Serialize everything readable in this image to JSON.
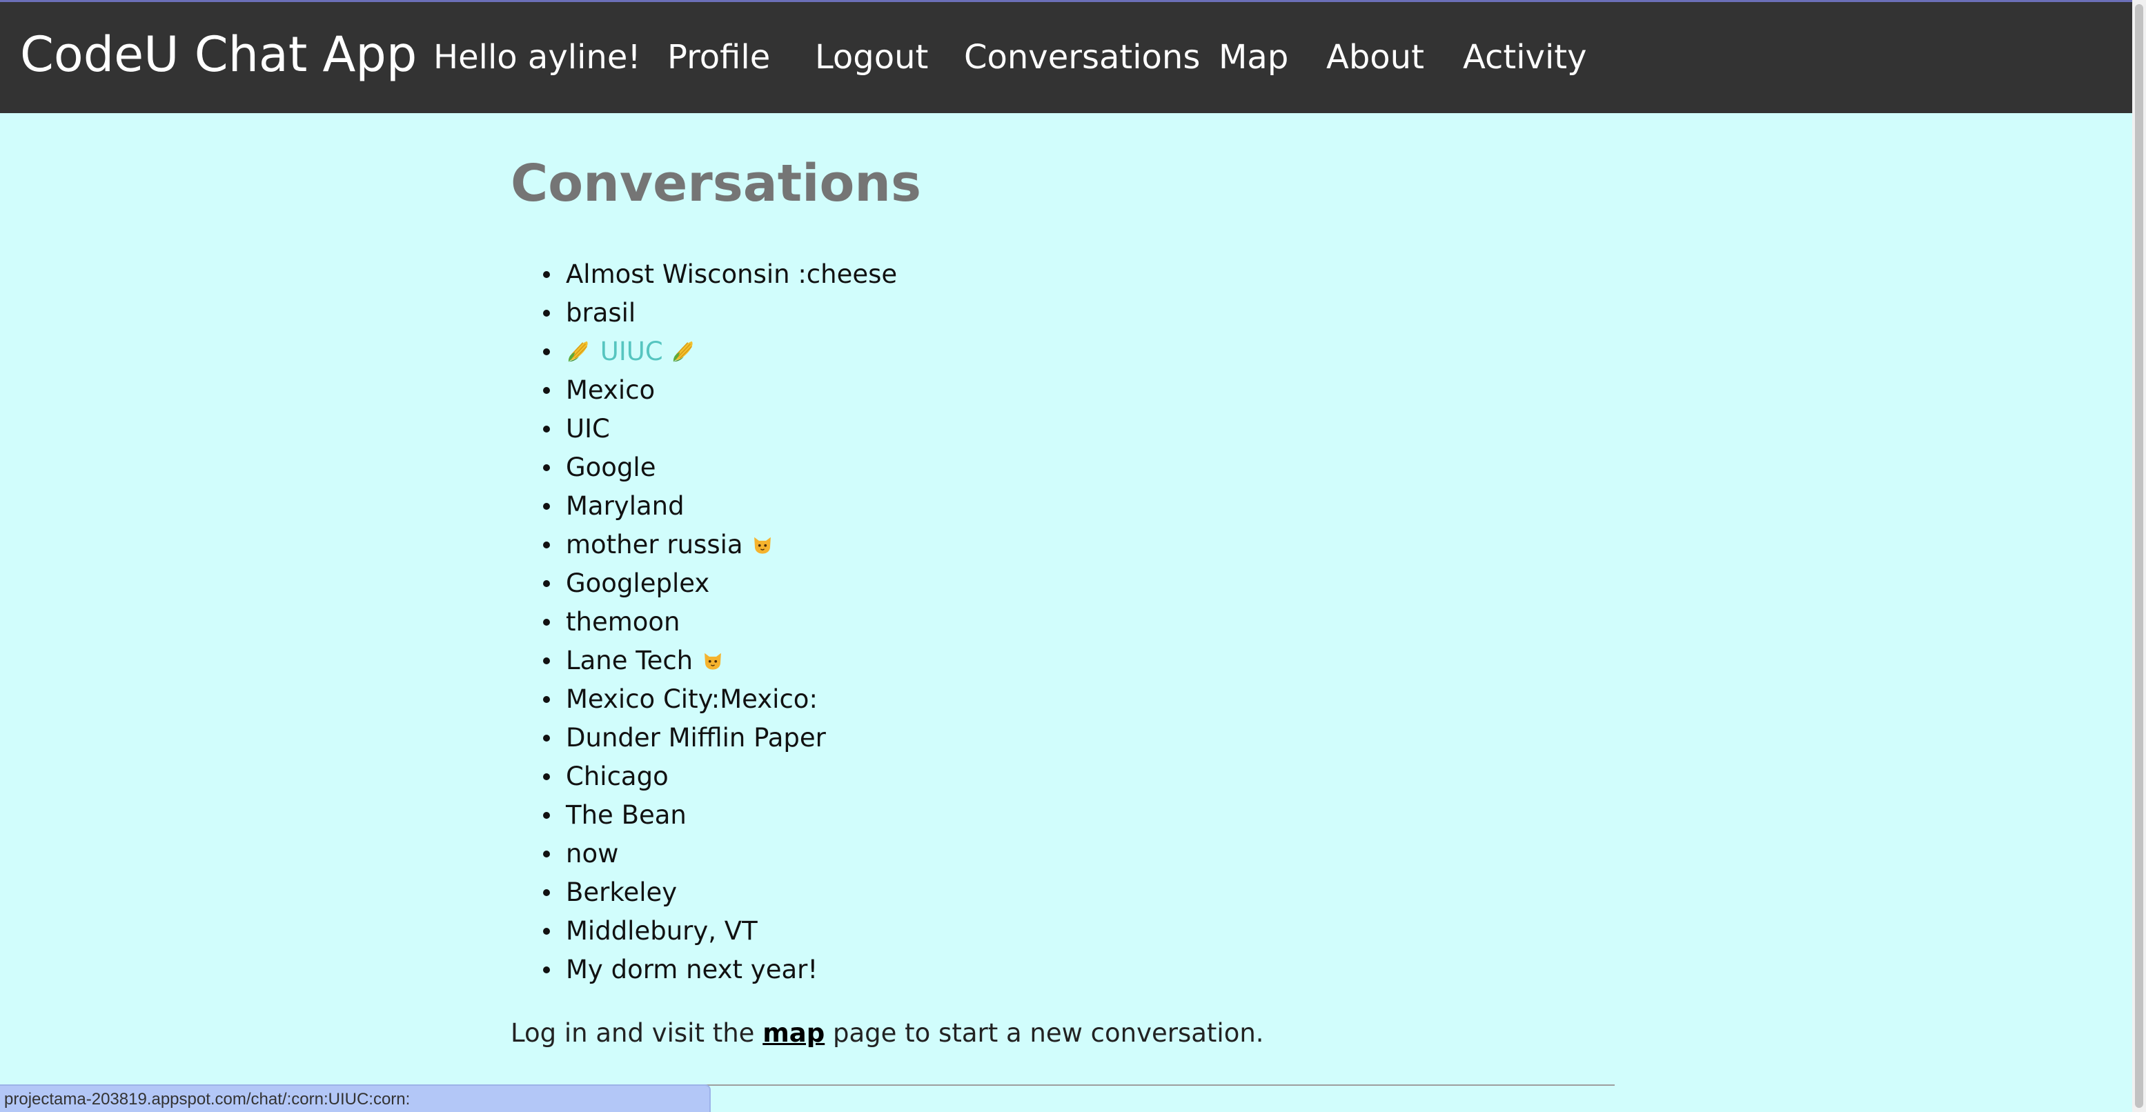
{
  "nav": {
    "brand": "CodeU Chat App",
    "greeting": "Hello ayline!",
    "profile": "Profile",
    "logout": "Logout",
    "conversations": "Conversations",
    "map": "Map",
    "about": "About",
    "activity": "Activity"
  },
  "main": {
    "title": "Conversations",
    "conversations": [
      {
        "label": "Almost Wisconsin :cheese"
      },
      {
        "label": "brasil"
      },
      {
        "label": "UIUC",
        "icon": "corn-icon",
        "highlighted": true
      },
      {
        "label": "Mexico"
      },
      {
        "label": "UIC"
      },
      {
        "label": "Google"
      },
      {
        "label": "Maryland"
      },
      {
        "label": "mother russia",
        "icon": "cat-icon"
      },
      {
        "label": "Googleplex"
      },
      {
        "label": "themoon"
      },
      {
        "label": "Lane Tech",
        "icon": "cat-icon"
      },
      {
        "label": "Mexico City:Mexico:"
      },
      {
        "label": "Dunder Mifflin Paper"
      },
      {
        "label": "Chicago"
      },
      {
        "label": "The Bean"
      },
      {
        "label": "now"
      },
      {
        "label": "Berkeley"
      },
      {
        "label": "Middlebury, VT"
      },
      {
        "label": "My dorm next year!"
      }
    ],
    "footer_before": "Log in and visit the ",
    "footer_link": "map",
    "footer_after": " page to start a new conversation."
  },
  "status_bar": {
    "url": "projectama-203819.appspot.com/chat/:corn:UIUC:corn:"
  },
  "colors": {
    "page_bg": "#d1fdfc",
    "navbar_bg": "#333333",
    "highlight_link": "#56c5c0",
    "title": "#757575"
  }
}
